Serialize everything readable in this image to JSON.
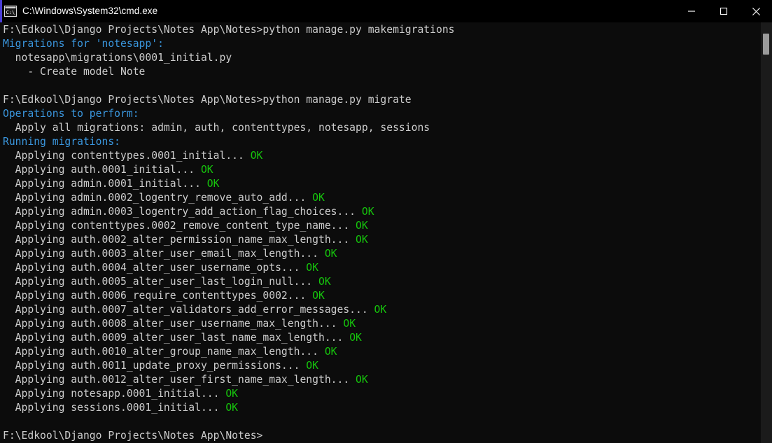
{
  "titlebar": {
    "icon": "cmd-icon",
    "title": "C:\\Windows\\System32\\cmd.exe",
    "buttons": [
      {
        "name": "minimize",
        "label": "—"
      },
      {
        "name": "maximize",
        "label": "□"
      },
      {
        "name": "close",
        "label": "✕"
      }
    ]
  },
  "colors": {
    "background": "#0c0c0c",
    "titlebar_background": "#000000",
    "default_text": "#cccccc",
    "header_text": "#3a96dd",
    "ok_text": "#16c60c",
    "accent_stripe": "#4b3ed6",
    "scrollbar_track": "#1b1b1b",
    "scrollbar_thumb": "#9b9b9b"
  },
  "terminal": {
    "prompt": "F:\\Edkool\\Django Projects\\Notes App\\Notes>",
    "lines": [
      {
        "segments": [
          {
            "text": "F:\\Edkool\\Django Projects\\Notes App\\Notes>python manage.py makemigrations",
            "color": "default"
          }
        ]
      },
      {
        "segments": [
          {
            "text": "Migrations for 'notesapp':",
            "color": "cyan"
          }
        ]
      },
      {
        "segments": [
          {
            "text": "  notesapp\\migrations\\0001_initial.py",
            "color": "default"
          }
        ]
      },
      {
        "segments": [
          {
            "text": "    - Create model Note",
            "color": "default"
          }
        ]
      },
      {
        "segments": [
          {
            "text": "",
            "color": "default"
          }
        ]
      },
      {
        "segments": [
          {
            "text": "F:\\Edkool\\Django Projects\\Notes App\\Notes>python manage.py migrate",
            "color": "default"
          }
        ]
      },
      {
        "segments": [
          {
            "text": "Operations to perform:",
            "color": "cyan"
          }
        ]
      },
      {
        "segments": [
          {
            "text": "  Apply all migrations: admin, auth, contenttypes, notesapp, sessions",
            "color": "default"
          }
        ]
      },
      {
        "segments": [
          {
            "text": "Running migrations:",
            "color": "cyan"
          }
        ]
      },
      {
        "segments": [
          {
            "text": "  Applying contenttypes.0001_initial...",
            "color": "default"
          },
          {
            "text": " OK",
            "color": "green"
          }
        ]
      },
      {
        "segments": [
          {
            "text": "  Applying auth.0001_initial...",
            "color": "default"
          },
          {
            "text": " OK",
            "color": "green"
          }
        ]
      },
      {
        "segments": [
          {
            "text": "  Applying admin.0001_initial...",
            "color": "default"
          },
          {
            "text": " OK",
            "color": "green"
          }
        ]
      },
      {
        "segments": [
          {
            "text": "  Applying admin.0002_logentry_remove_auto_add...",
            "color": "default"
          },
          {
            "text": " OK",
            "color": "green"
          }
        ]
      },
      {
        "segments": [
          {
            "text": "  Applying admin.0003_logentry_add_action_flag_choices...",
            "color": "default"
          },
          {
            "text": " OK",
            "color": "green"
          }
        ]
      },
      {
        "segments": [
          {
            "text": "  Applying contenttypes.0002_remove_content_type_name...",
            "color": "default"
          },
          {
            "text": " OK",
            "color": "green"
          }
        ]
      },
      {
        "segments": [
          {
            "text": "  Applying auth.0002_alter_permission_name_max_length...",
            "color": "default"
          },
          {
            "text": " OK",
            "color": "green"
          }
        ]
      },
      {
        "segments": [
          {
            "text": "  Applying auth.0003_alter_user_email_max_length...",
            "color": "default"
          },
          {
            "text": " OK",
            "color": "green"
          }
        ]
      },
      {
        "segments": [
          {
            "text": "  Applying auth.0004_alter_user_username_opts...",
            "color": "default"
          },
          {
            "text": " OK",
            "color": "green"
          }
        ]
      },
      {
        "segments": [
          {
            "text": "  Applying auth.0005_alter_user_last_login_null...",
            "color": "default"
          },
          {
            "text": " OK",
            "color": "green"
          }
        ]
      },
      {
        "segments": [
          {
            "text": "  Applying auth.0006_require_contenttypes_0002...",
            "color": "default"
          },
          {
            "text": " OK",
            "color": "green"
          }
        ]
      },
      {
        "segments": [
          {
            "text": "  Applying auth.0007_alter_validators_add_error_messages...",
            "color": "default"
          },
          {
            "text": " OK",
            "color": "green"
          }
        ]
      },
      {
        "segments": [
          {
            "text": "  Applying auth.0008_alter_user_username_max_length...",
            "color": "default"
          },
          {
            "text": " OK",
            "color": "green"
          }
        ]
      },
      {
        "segments": [
          {
            "text": "  Applying auth.0009_alter_user_last_name_max_length...",
            "color": "default"
          },
          {
            "text": " OK",
            "color": "green"
          }
        ]
      },
      {
        "segments": [
          {
            "text": "  Applying auth.0010_alter_group_name_max_length...",
            "color": "default"
          },
          {
            "text": " OK",
            "color": "green"
          }
        ]
      },
      {
        "segments": [
          {
            "text": "  Applying auth.0011_update_proxy_permissions...",
            "color": "default"
          },
          {
            "text": " OK",
            "color": "green"
          }
        ]
      },
      {
        "segments": [
          {
            "text": "  Applying auth.0012_alter_user_first_name_max_length...",
            "color": "default"
          },
          {
            "text": " OK",
            "color": "green"
          }
        ]
      },
      {
        "segments": [
          {
            "text": "  Applying notesapp.0001_initial...",
            "color": "default"
          },
          {
            "text": " OK",
            "color": "green"
          }
        ]
      },
      {
        "segments": [
          {
            "text": "  Applying sessions.0001_initial...",
            "color": "default"
          },
          {
            "text": " OK",
            "color": "green"
          }
        ]
      },
      {
        "segments": [
          {
            "text": "",
            "color": "default"
          }
        ]
      },
      {
        "segments": [
          {
            "text": "F:\\Edkool\\Django Projects\\Notes App\\Notes>",
            "color": "default"
          }
        ]
      }
    ]
  }
}
